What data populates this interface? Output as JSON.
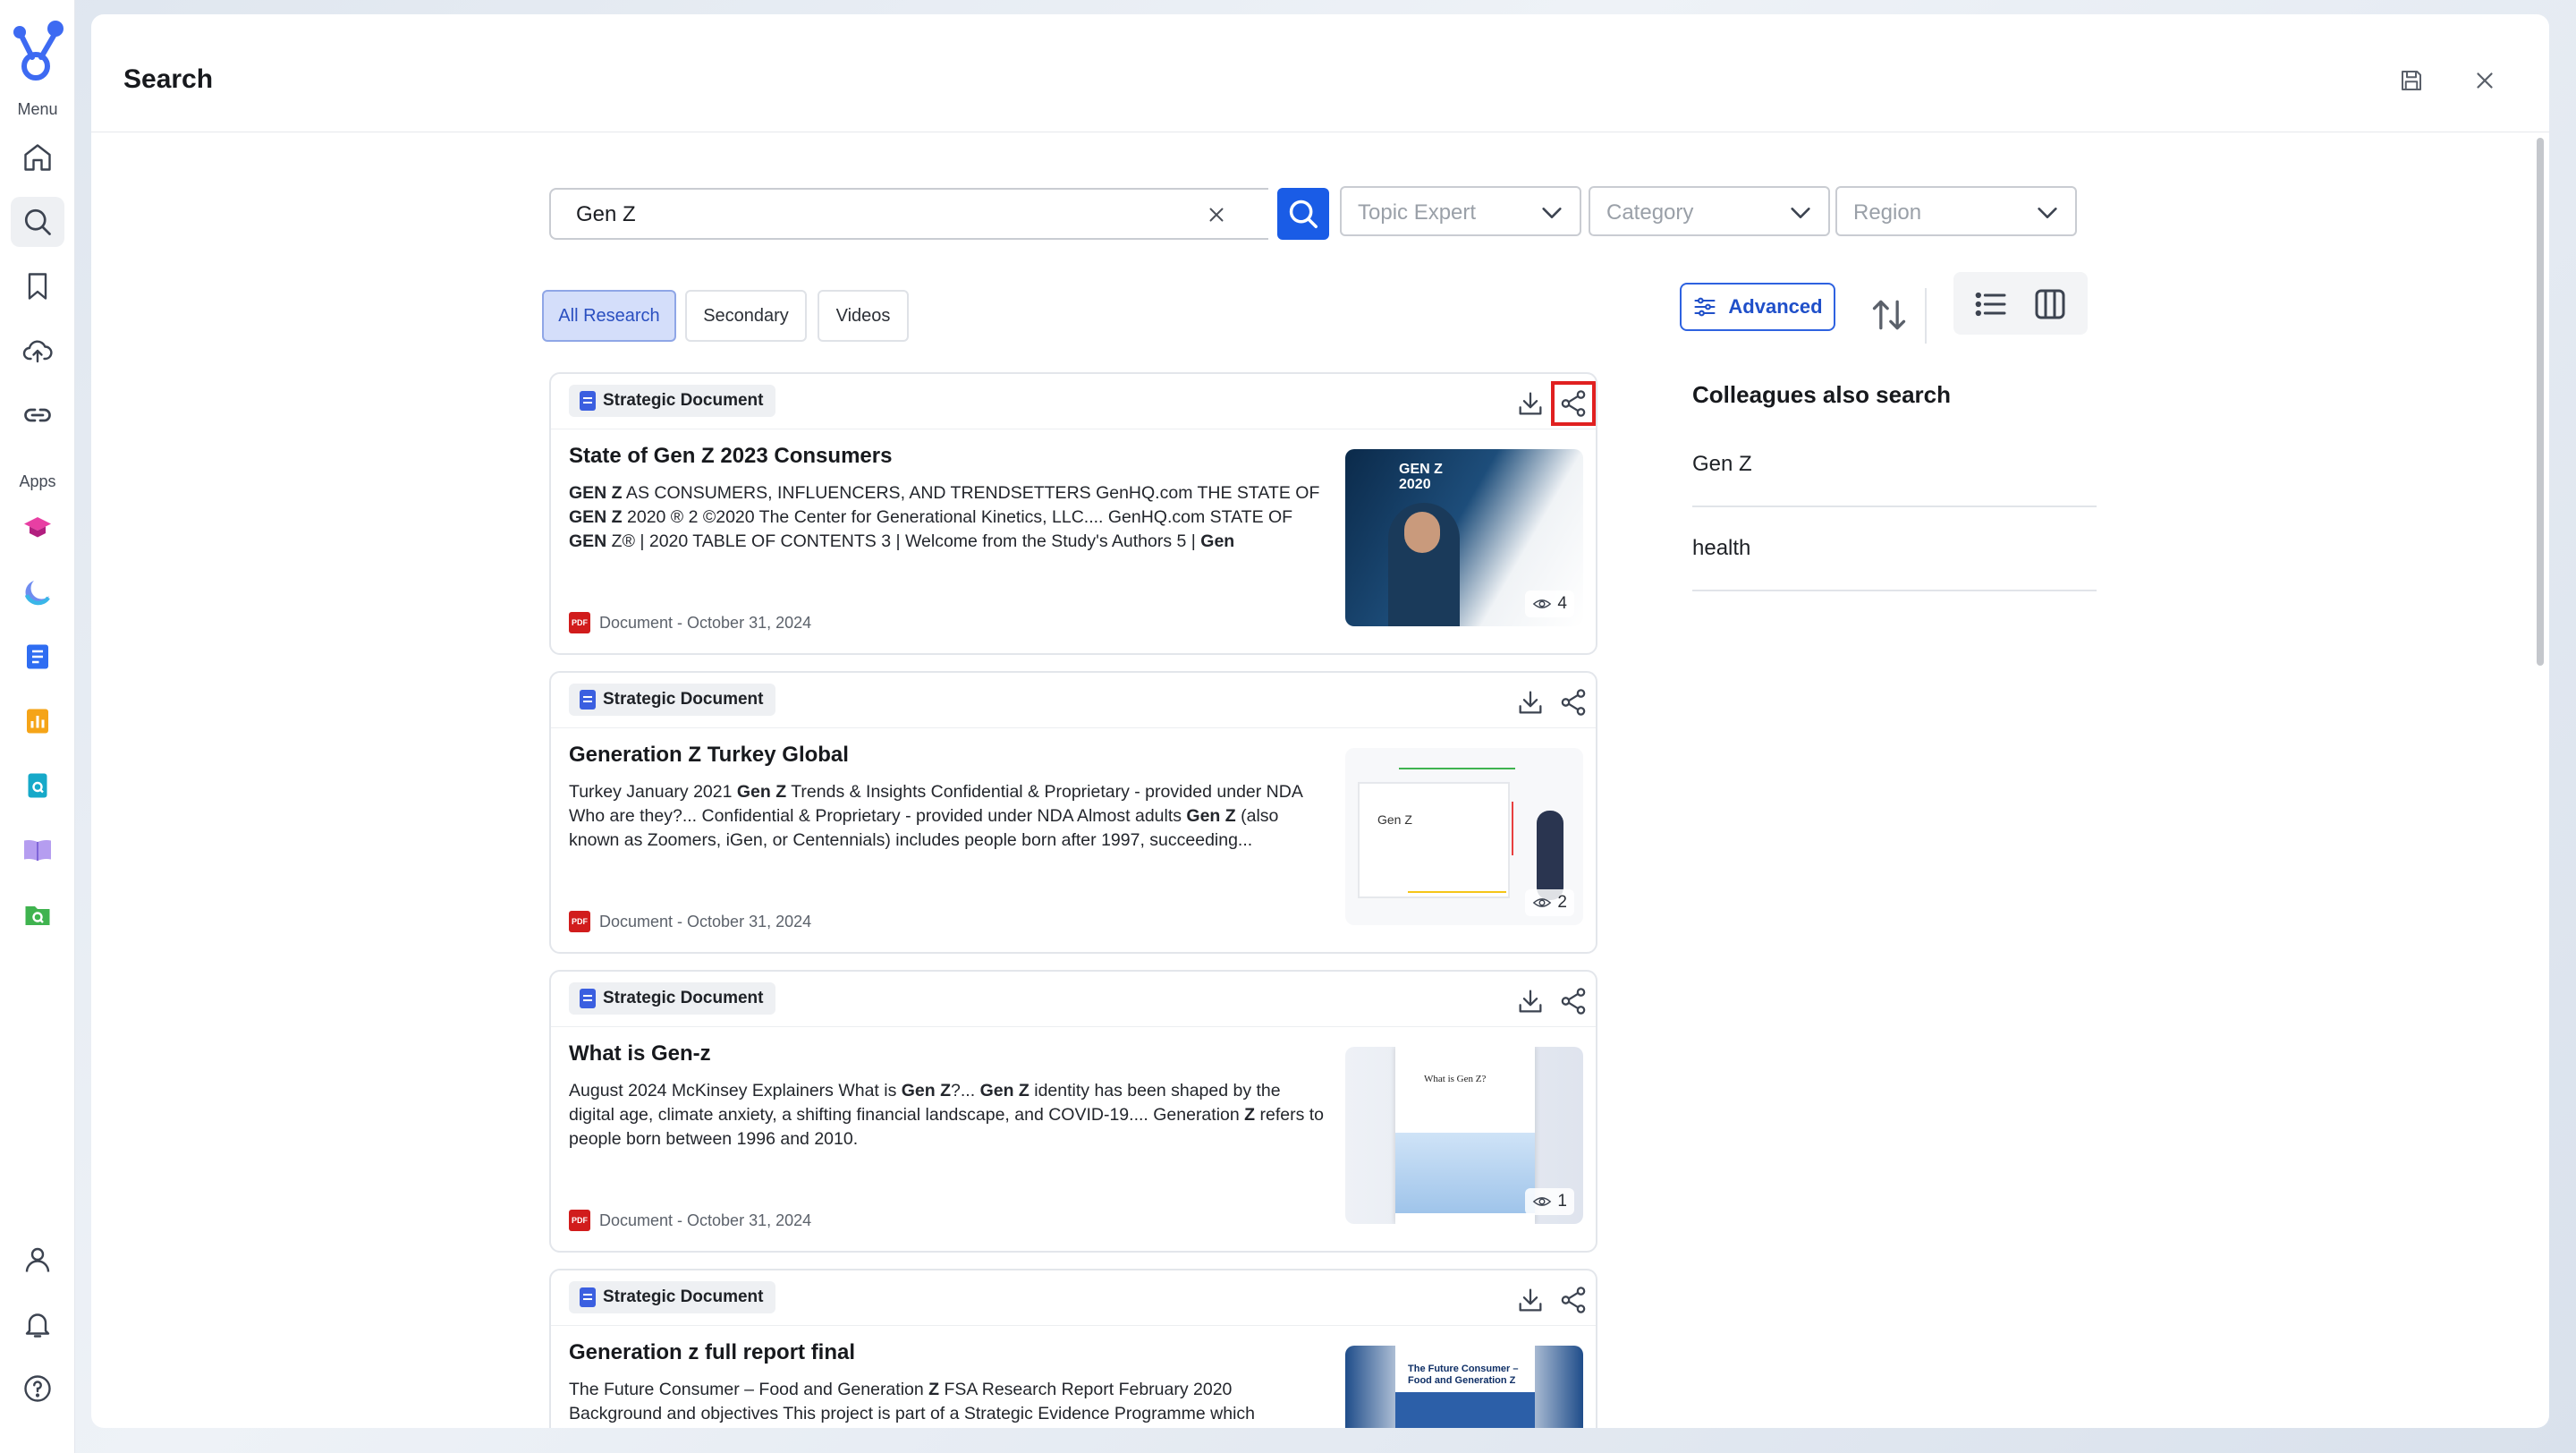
{
  "rail": {
    "menu_label": "Menu",
    "apps_label": "Apps"
  },
  "header": {
    "title": "Search"
  },
  "search": {
    "query": "Gen Z",
    "filters": [
      {
        "placeholder": "Topic Expert"
      },
      {
        "placeholder": "Category"
      },
      {
        "placeholder": "Region"
      }
    ]
  },
  "tabs": [
    {
      "label": "All Research",
      "active": true
    },
    {
      "label": "Secondary",
      "active": false
    },
    {
      "label": "Videos",
      "active": false
    }
  ],
  "toolbar": {
    "advanced_label": "Advanced"
  },
  "results": [
    {
      "badge": "Strategic Document",
      "title": "State of Gen Z 2023 Consumers",
      "meta": "Document - October 31, 2024",
      "views": "4",
      "thumb_text": "GEN Z 2020"
    },
    {
      "badge": "Strategic Document",
      "title": "Generation Z Turkey Global",
      "meta": "Document - October 31, 2024",
      "views": "2",
      "thumb_text": "Gen Z"
    },
    {
      "badge": "Strategic Document",
      "title": "What is Gen-z",
      "meta": "Document - October 31, 2024",
      "views": "1",
      "thumb_text": "What is Gen Z?"
    },
    {
      "badge": "Strategic Document",
      "title": "Generation z full report final",
      "meta": "",
      "views": "",
      "thumb_text": "The Future Consumer – Food and Generation Z"
    }
  ],
  "colleagues": {
    "heading": "Colleagues also search",
    "items": [
      "Gen Z",
      "health"
    ]
  },
  "colors": {
    "accent": "#1a5ce6",
    "highlight": "#e02020",
    "pdf": "#d11c1c"
  }
}
